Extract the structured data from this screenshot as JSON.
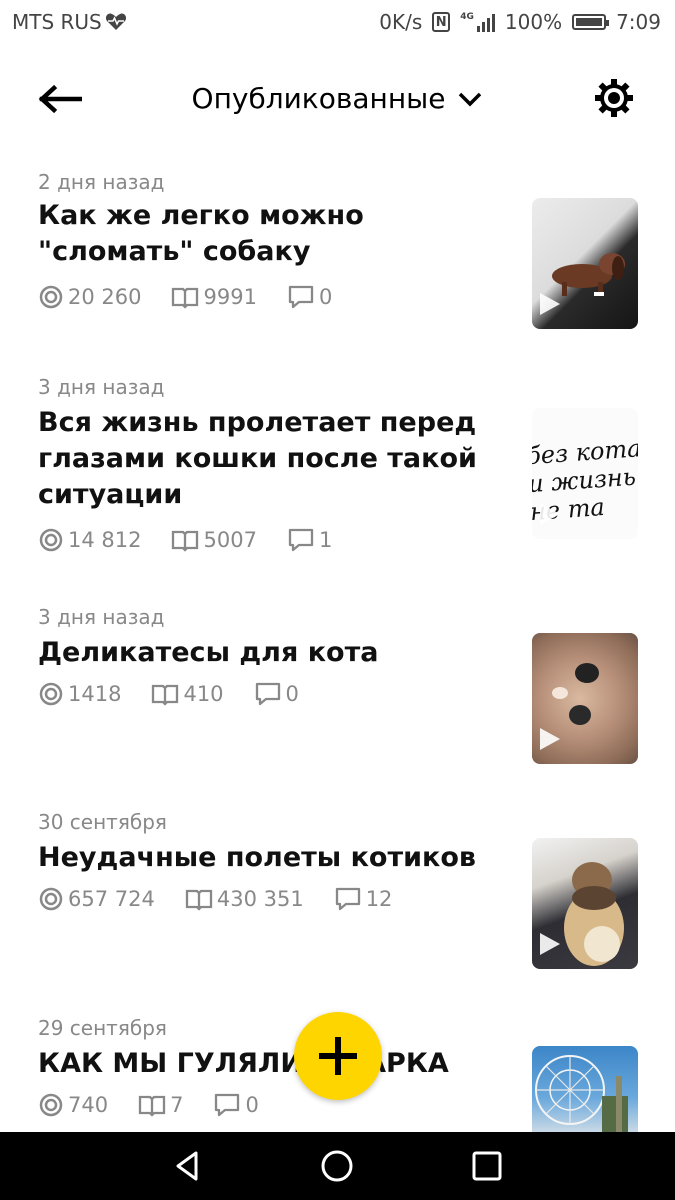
{
  "status_bar": {
    "carrier": "MTS RUS",
    "speed": "0K/s",
    "network": "4G",
    "battery": "100%",
    "time": "7:09"
  },
  "header": {
    "title": "Опубликованные",
    "icons": [
      "back-arrow-icon",
      "chevron-down-icon",
      "gear-icon"
    ]
  },
  "posts": [
    {
      "date": "2 дня назад",
      "title": "Как же легко можно \"сломать\" собаку",
      "views": "20 260",
      "reads": "9991",
      "comments": "0"
    },
    {
      "date": "3 дня назад",
      "title": "Вся жизнь пролетает перед глазами кошки после такой ситуации",
      "views": "14 812",
      "reads": "5007",
      "comments": "1"
    },
    {
      "date": "3 дня назад",
      "title": "Деликатесы для кота",
      "views": "1418",
      "reads": "410",
      "comments": "0"
    },
    {
      "date": "30 сентября",
      "title": "Неудачные полеты котиков",
      "views": "657 724",
      "reads": "430 351",
      "comments": "12"
    },
    {
      "date": "29 сентября",
      "title": "КАК МЫ ГУЛЯЛИ У ПАРКА",
      "views": "740",
      "reads": "7",
      "comments": "0"
    }
  ],
  "fab": {
    "icon": "plus-icon",
    "color": "#ffd500"
  },
  "thumb_text": "без кота и жизнь не та",
  "nav": {
    "icons": [
      "back-triangle-icon",
      "home-circle-icon",
      "recents-square-icon"
    ]
  }
}
